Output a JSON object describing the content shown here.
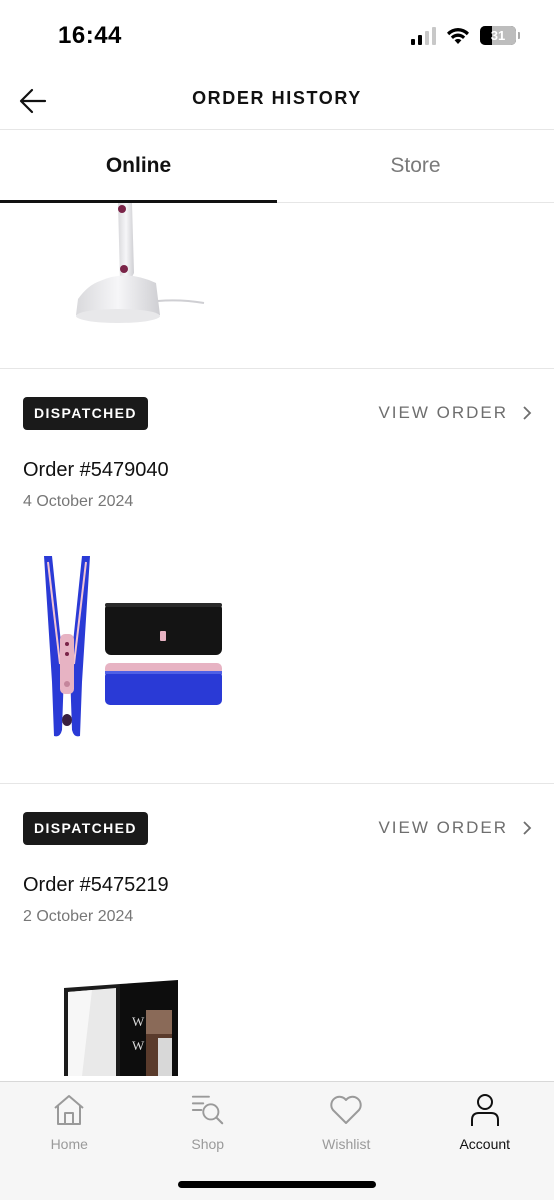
{
  "status_bar": {
    "time": "16:44",
    "battery": "31",
    "icons": [
      "signal-icon",
      "wifi-icon",
      "battery-icon"
    ]
  },
  "header": {
    "title": "ORDER HISTORY",
    "back_icon": "back-arrow-icon"
  },
  "tabs": [
    {
      "label": "Online",
      "active": true
    },
    {
      "label": "Store",
      "active": false
    }
  ],
  "orders": [
    {
      "status": "DISPATCHED",
      "view_label": "VIEW ORDER",
      "number": "Order #5479040",
      "date": "4 October 2024",
      "products": [
        "hair-straightener",
        "storage-case"
      ]
    },
    {
      "status": "DISPATCHED",
      "view_label": "VIEW ORDER",
      "number": "Order #5475219",
      "date": "2 October 2024",
      "products": [
        "cosmetic-kit"
      ]
    }
  ],
  "partial_order": {
    "products": [
      "hair-steamer"
    ]
  },
  "bottom_nav": [
    {
      "label": "Home",
      "icon": "home-icon",
      "active": false
    },
    {
      "label": "Shop",
      "icon": "shop-search-icon",
      "active": false
    },
    {
      "label": "Wishlist",
      "icon": "heart-icon",
      "active": false
    },
    {
      "label": "Account",
      "icon": "person-icon",
      "active": true
    }
  ],
  "colors": {
    "badge_bg": "#1a1a1a",
    "accent": "#111111",
    "muted_text": "#777777",
    "nav_bg": "#f6f6f6"
  }
}
